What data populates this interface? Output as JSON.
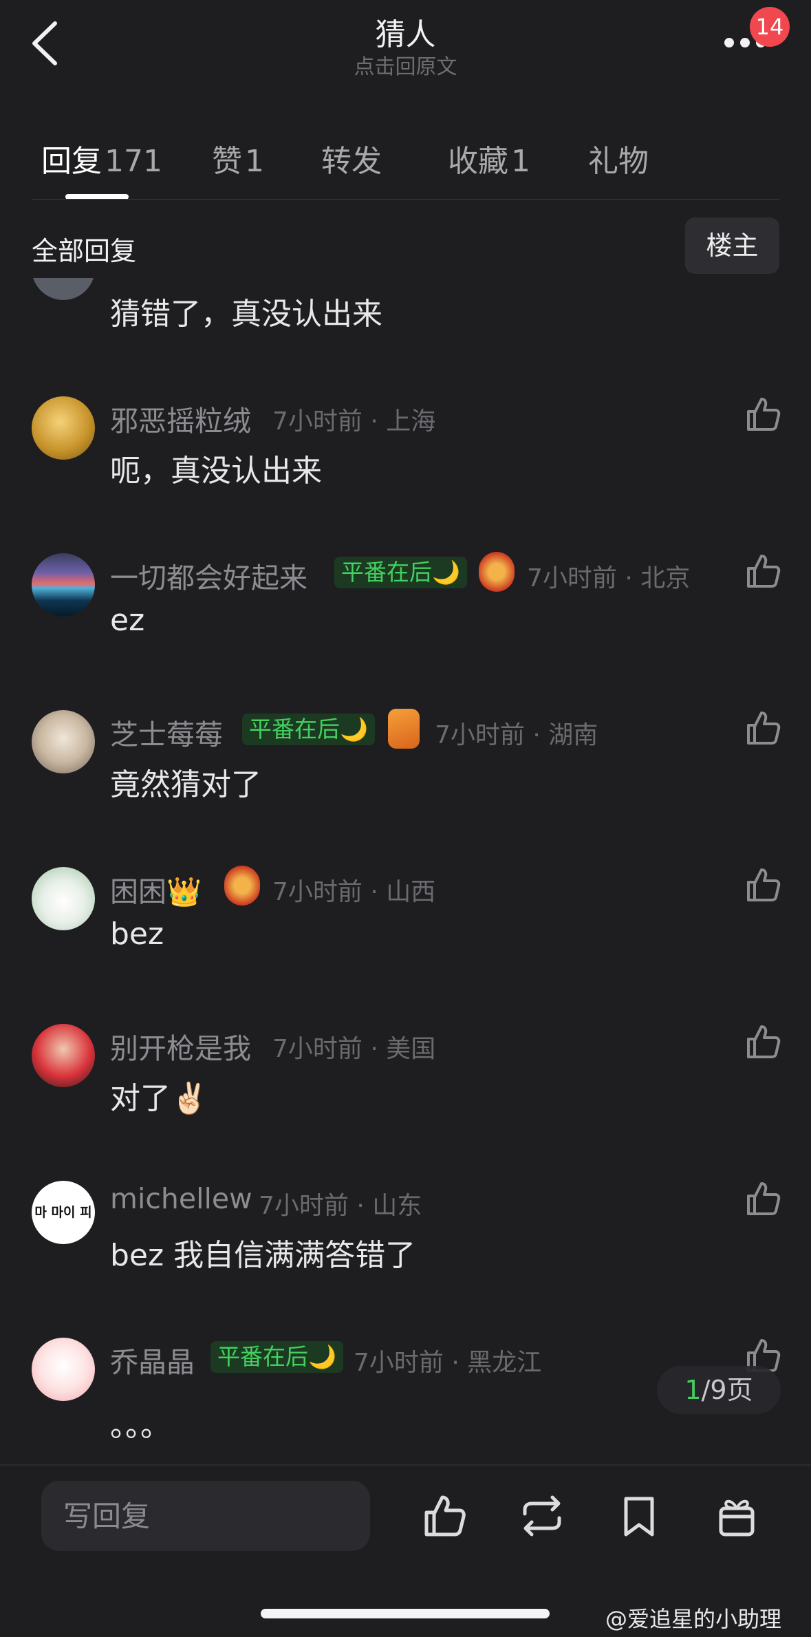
{
  "header": {
    "title": "猜人",
    "subtitle": "点击回原文",
    "badge_count": "14"
  },
  "tabs": [
    {
      "label": "回复",
      "count": "171",
      "active": true
    },
    {
      "label": "赞",
      "count": "1",
      "active": false
    },
    {
      "label": "转发",
      "count": "",
      "active": false
    },
    {
      "label": "收藏",
      "count": "1",
      "active": false
    },
    {
      "label": "礼物",
      "count": "",
      "active": false
    }
  ],
  "filter": {
    "section_title": "全部回复",
    "owner_button": "楼主"
  },
  "comments": [
    {
      "name": "",
      "meta": "",
      "text": "猜错了，真没认出来"
    },
    {
      "name": "邪恶摇粒绒",
      "meta": "7小时前 · 上海",
      "text": "呃，真没认出来"
    },
    {
      "name": "一切都会好起来",
      "medal": "平番在后🌙",
      "meta": "7小时前 · 北京",
      "text": "ez"
    },
    {
      "name": "芝士莓莓",
      "medal": "平番在后🌙",
      "meta": "7小时前 · 湖南",
      "text": "竟然猜对了"
    },
    {
      "name": "困困👑",
      "meta": "7小时前 · 山西",
      "text": "bez"
    },
    {
      "name": "别开枪是我",
      "meta": "7小时前 · 美国",
      "text": "对了✌🏻"
    },
    {
      "name": "michellew",
      "meta": "7小时前 · 山东",
      "text": "bez 我自信满满答错了",
      "avatar_text": "마 마이 피"
    },
    {
      "name": "乔晶晶",
      "medal": "平番在后🌙",
      "meta": "7小时前 · 黑龙江",
      "text": "。。。"
    }
  ],
  "pagination": {
    "current": "1",
    "total_label": "/9页"
  },
  "bottom_bar": {
    "reply_placeholder": "写回复",
    "icons": [
      "like-icon",
      "repost-icon",
      "bookmark-icon",
      "gift-icon"
    ]
  },
  "watermark": "@爱追星的小助理",
  "colors": {
    "background": "#1e1e21",
    "accent_green": "#43d05f",
    "badge_red": "#f0484e"
  }
}
